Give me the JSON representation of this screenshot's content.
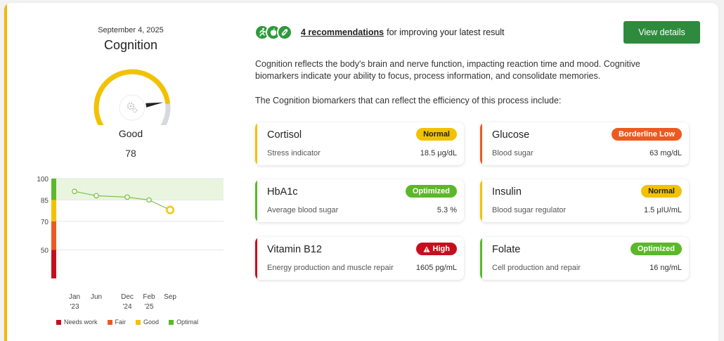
{
  "header": {
    "date": "September 4, 2025",
    "title": "Cognition",
    "rating": "Good",
    "score": "78"
  },
  "gauge": {
    "score": 78,
    "max": 100,
    "colors": {
      "filled": "#f2c200",
      "track": "#d7d9dc",
      "needle": "#222222"
    },
    "center_icon": "gears-icon"
  },
  "chart_data": {
    "type": "line",
    "x": [
      "Jan '23",
      "Jun",
      "Dec '24",
      "Feb '25",
      "Sep"
    ],
    "x_ticks": [
      {
        "line1": "Jan",
        "line2": "'23"
      },
      {
        "line1": "Jun",
        "line2": ""
      },
      {
        "line1": "Dec",
        "line2": "'24"
      },
      {
        "line1": "Feb",
        "line2": "'25"
      },
      {
        "line1": "Sep",
        "line2": ""
      }
    ],
    "series": [
      {
        "values": [
          91,
          88,
          87,
          85,
          78
        ]
      }
    ],
    "ylim": [
      30,
      100
    ],
    "yticks": [
      100,
      85,
      70,
      50
    ],
    "bands": [
      {
        "name": "Optimal",
        "from": 85,
        "to": 100,
        "color": "#5cb82a"
      },
      {
        "name": "Good",
        "from": 70,
        "to": 85,
        "color": "#f2c200"
      },
      {
        "name": "Fair",
        "from": 50,
        "to": 70,
        "color": "#ec5a20"
      },
      {
        "name": "Needs work",
        "from": 30,
        "to": 50,
        "color": "#c4101e"
      }
    ],
    "optimal_zone": {
      "from": 85,
      "to": 100,
      "color": "#eaf5e0"
    },
    "line_color": "#7dc24a",
    "latest_color": "#f2c200",
    "grid": true
  },
  "legend": [
    {
      "label": "Needs work",
      "color": "#c4101e"
    },
    {
      "label": "Fair",
      "color": "#ec5a20"
    },
    {
      "label": "Good",
      "color": "#f2c200"
    },
    {
      "label": "Optimal",
      "color": "#5cb82a"
    }
  ],
  "recommendations": {
    "icons": [
      "running-person-icon",
      "apple-icon",
      "capsule-icon"
    ],
    "link_text": "4 recommendations",
    "text": "for improving your latest result",
    "button_label": "View details"
  },
  "description": "Cognition reflects the body's brain and nerve function, impacting reaction time and mood. Cognitive biomarkers indicate your ability to focus, process information, and consolidate memories.",
  "subdescription": "The Cognition biomarkers that can reflect the efficiency of this process include:",
  "biomarkers": [
    {
      "name": "Cortisol",
      "status": "Normal",
      "subtitle": "Stress indicator",
      "value": "18.5 μg/dL",
      "color": "#f2c200",
      "badge_text_color": "#222222"
    },
    {
      "name": "Glucose",
      "status": "Borderline Low",
      "subtitle": "Blood sugar",
      "value": "63 mg/dL",
      "color": "#ec5a20",
      "badge_text_color": "#ffffff"
    },
    {
      "name": "HbA1c",
      "status": "Optimized",
      "subtitle": "Average blood sugar",
      "value": "5.3 %",
      "color": "#5cb82a",
      "badge_text_color": "#ffffff"
    },
    {
      "name": "Insulin",
      "status": "Normal",
      "subtitle": "Blood sugar regulator",
      "value": "1.5 μIU/mL",
      "color": "#f2c200",
      "badge_text_color": "#222222"
    },
    {
      "name": "Vitamin B12",
      "status": "High",
      "subtitle": "Energy production and muscle repair",
      "value": "1605 pg/mL",
      "color": "#c4101e",
      "badge_text_color": "#ffffff",
      "badge_icon": "warning-icon"
    },
    {
      "name": "Folate",
      "status": "Optimized",
      "subtitle": "Cell production and repair",
      "value": "16 ng/mL",
      "color": "#5cb82a",
      "badge_text_color": "#ffffff"
    }
  ]
}
